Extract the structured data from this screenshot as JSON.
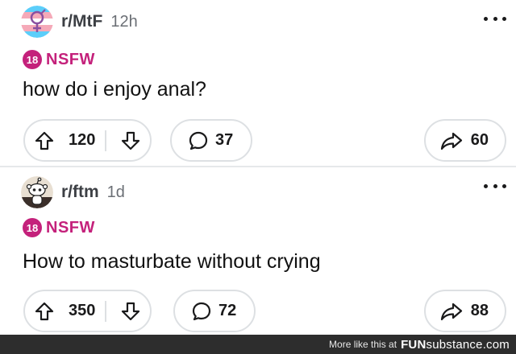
{
  "posts": [
    {
      "subreddit": "r/MtF",
      "age": "12h",
      "nsfw_badge": "18",
      "nsfw_label": "NSFW",
      "title": "how do i enjoy anal?",
      "upvotes": "120",
      "comments": "37",
      "shares": "60",
      "avatar_icon": "trans-symbol-icon"
    },
    {
      "subreddit": "r/ftm",
      "age": "1d",
      "nsfw_badge": "18",
      "nsfw_label": "NSFW",
      "title": "How to masturbate without crying",
      "upvotes": "350",
      "comments": "72",
      "shares": "88",
      "avatar_icon": "snoo-mascot-icon"
    }
  ],
  "footer": {
    "prefix": "More like this at",
    "brand_bold": "FUN",
    "brand_light": "substance",
    "brand_suffix": ".com"
  },
  "colors": {
    "nsfw": "#c4217b",
    "pill_border": "#dde0e3",
    "footer_bg": "#2d2d2d"
  }
}
